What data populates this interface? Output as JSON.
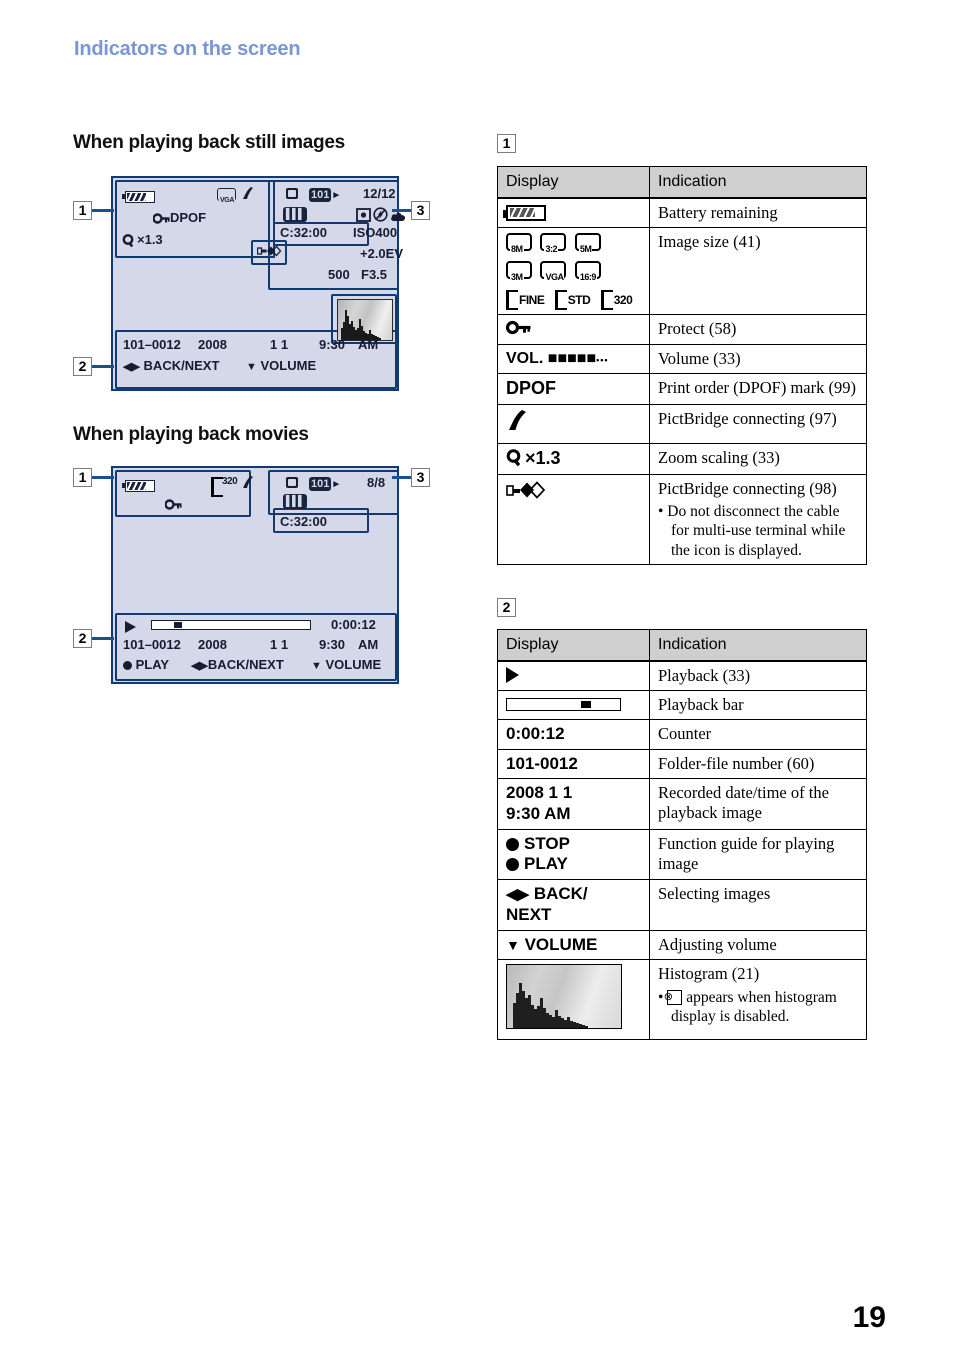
{
  "header": {
    "title": "Indicators on the screen"
  },
  "page_number": "19",
  "colors": {
    "heading_blue": "#7b96d4",
    "lcd_bg": "#d5d8e9",
    "lcd_border": "#123a72",
    "table_header_bg": "#cfcfcf"
  },
  "sections": {
    "still": {
      "heading": "When playing back still images",
      "callout_1": "1",
      "callout_2": "2",
      "callout_3": "3"
    },
    "movie": {
      "heading": "When playing back movies",
      "callout_1": "1",
      "callout_2": "2",
      "callout_3": "3"
    }
  },
  "lcd_still": {
    "battery": "battery-icon",
    "image_size": "VGA",
    "pictbridge": "pictbridge-icon",
    "protect": "protect-key-icon",
    "dpof": "DPOF",
    "zoom": "×1.3",
    "usb": "usb-connect-icon",
    "media": "media-icon",
    "folder": "101",
    "counter": "12/12",
    "mode": "mode-icon",
    "metering": "metering-icon",
    "flash_off": "flash-off-icon",
    "wb": "cloudy-wb-icon",
    "cfile": "C:32:00",
    "iso": "ISO400",
    "ev": "+2.0EV",
    "shutter": "500",
    "aperture": "F3.5",
    "folder_file": "101–0012",
    "year": "2008",
    "date": "1 1",
    "time": "9:30",
    "ampm": "AM",
    "guide_back_next": "BACK/NEXT",
    "guide_volume": "VOLUME"
  },
  "lcd_movie": {
    "battery": "battery-icon",
    "image_size": "320",
    "pictbridge": "pictbridge-icon",
    "protect": "protect-key-icon",
    "media": "media-icon",
    "folder": "101",
    "counter": "8/8",
    "mode": "mode-icon",
    "cfile": "C:32:00",
    "play": "play-icon",
    "elapsed": "0:00:12",
    "folder_file": "101–0012",
    "year": "2008",
    "date": "1 1",
    "time": "9:30",
    "ampm": "AM",
    "guide_play": "PLAY",
    "guide_back_next": "BACK/NEXT",
    "guide_volume": "VOLUME"
  },
  "table1": {
    "label": "1",
    "columns": [
      "Display",
      "Indication"
    ],
    "rows": [
      {
        "display_icon": "battery-icon",
        "indication": "Battery remaining"
      },
      {
        "display_icon": "image-size-icons",
        "indication": "Image size (41)",
        "icon_labels": [
          "8M",
          "3:2",
          "5M",
          "3M",
          "VGA",
          "16:9",
          "FINE",
          "STD",
          "320"
        ]
      },
      {
        "display_icon": "protect-key-icon",
        "indication": "Protect (58)"
      },
      {
        "display_text": "VOL.",
        "display_icon": "volume-bars-icon",
        "indication": "Volume (33)"
      },
      {
        "display_text": "DPOF",
        "indication": "Print order (DPOF) mark (99)"
      },
      {
        "display_icon": "pictbridge-icon",
        "indication": "PictBridge connecting (97)"
      },
      {
        "display_text": "×1.3",
        "display_icon": "zoom-magnifier-icon",
        "indication": "Zoom scaling (33)"
      },
      {
        "display_icon": "usb-connect-icon",
        "indication": "PictBridge connecting (98)",
        "note": "• Do not disconnect the cable for multi-use terminal while the icon is displayed."
      }
    ]
  },
  "table2": {
    "label": "2",
    "columns": [
      "Display",
      "Indication"
    ],
    "rows": [
      {
        "display_icon": "play-triangle-icon",
        "indication": "Playback (33)"
      },
      {
        "display_icon": "playback-bar-icon",
        "indication": "Playback bar"
      },
      {
        "display_text": "0:00:12",
        "indication": "Counter"
      },
      {
        "display_text": "101-0012",
        "indication": "Folder-file number (60)"
      },
      {
        "display_text": "2008 1 1",
        "display_text2": "9:30 AM",
        "indication": "Recorded date/time of the playback image"
      },
      {
        "display_text": "STOP",
        "display_text2": "PLAY",
        "display_icon": "circle-dot-icon",
        "indication": "Function guide for playing image"
      },
      {
        "display_text": "BACK/",
        "display_text2": "NEXT",
        "display_icon": "left-right-arrows-icon",
        "indication": "Selecting images"
      },
      {
        "display_text": "VOLUME",
        "display_icon": "down-arrow-icon",
        "indication": "Adjusting volume"
      },
      {
        "display_icon": "histogram-thumbnail-icon",
        "indication": "Histogram (21)",
        "note_pre": "•",
        "note_box": "⊗",
        "note": "appears when histogram display is disabled."
      }
    ]
  }
}
